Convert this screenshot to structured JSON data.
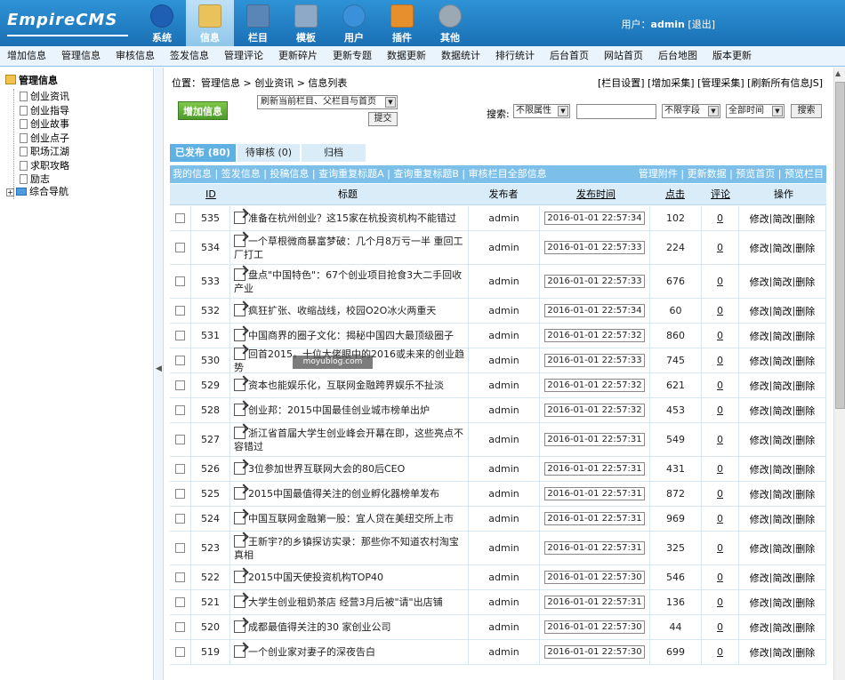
{
  "header": {
    "logo_text": "EmpireCMS",
    "nav": [
      {
        "label": "系统",
        "icon": "globe-icon"
      },
      {
        "label": "信息",
        "icon": "document-edit-icon",
        "active": true
      },
      {
        "label": "栏目",
        "icon": "folder-icon"
      },
      {
        "label": "模板",
        "icon": "window-icon"
      },
      {
        "label": "用户",
        "icon": "user-icon"
      },
      {
        "label": "插件",
        "icon": "tools-icon"
      },
      {
        "label": "其他",
        "icon": "gear-icon"
      }
    ],
    "user_label": "用户：",
    "user_name": "admin",
    "logout": "[退出]"
  },
  "subnav": [
    "增加信息",
    "管理信息",
    "审核信息",
    "签发信息",
    "管理评论",
    "更新碎片",
    "更新专题",
    "数据更新",
    "数据统计",
    "排行统计",
    "后台首页",
    "网站首页",
    "后台地图",
    "版本更新"
  ],
  "sidebar": {
    "root": "管理信息",
    "items": [
      "创业资讯",
      "创业指导",
      "创业故事",
      "创业点子",
      "职场江湖",
      "求职攻略",
      "励志"
    ],
    "group": "综合导航"
  },
  "main": {
    "crumb_prefix": "位置：",
    "crumb": "管理信息 > 创业资讯 > 信息列表",
    "toplinks": "[栏目设置] [增加采集] [管理采集] [刷新所有信息JS]",
    "add_button": "增加信息",
    "refresh_select": "刷新当前栏目、父栏目与首页",
    "submit": "提交",
    "search_label": "搜索:",
    "attr_select": "不限属性",
    "field_select": "不限字段",
    "time_select": "全部时间",
    "search_button": "搜索",
    "tabs": [
      "已发布 (80)",
      "待审核 (0)",
      "归档"
    ],
    "band_left": "我的信息 | 签发信息 | 投稿信息 | 查询重复标题A | 查询重复标题B | 审核栏目全部信息",
    "band_right": "管理附件 | 更新数据 | 预览首页 | 预览栏目",
    "columns": {
      "id": "ID",
      "title": "标题",
      "author": "发布者",
      "time": "发布时间",
      "hits": "点击",
      "comments": "评论",
      "ops": "操作"
    },
    "op_labels": {
      "edit": "修改",
      "simple": "简改",
      "delete": "删除"
    }
  },
  "rows": [
    {
      "id": "535",
      "title": "准备在杭州创业？这15家在杭投资机构不能错过",
      "author": "admin",
      "time": "2016-01-01 22:57:34",
      "hits": "102",
      "comments": "0",
      "tall": false
    },
    {
      "id": "534",
      "title": "一个草根微商暴富梦破：几个月8万亏一半 重回工厂打工",
      "author": "admin",
      "time": "2016-01-01 22:57:33",
      "hits": "224",
      "comments": "0",
      "tall": true
    },
    {
      "id": "533",
      "title": "盘点\"中国特色\"：67个创业项目抢食3大二手回收产业",
      "author": "admin",
      "time": "2016-01-01 22:57:33",
      "hits": "676",
      "comments": "0",
      "tall": true
    },
    {
      "id": "532",
      "title": "疯狂扩张、收缩战线，校园O2O冰火两重天",
      "author": "admin",
      "time": "2016-01-01 22:57:34",
      "hits": "60",
      "comments": "0",
      "tall": false
    },
    {
      "id": "531",
      "title": "中国商界的圈子文化：揭秘中国四大最顶级圈子",
      "author": "admin",
      "time": "2016-01-01 22:57:32",
      "hits": "860",
      "comments": "0",
      "tall": false
    },
    {
      "id": "530",
      "title": "回首2015，十位大佬眼中的2016或未来的创业趋势",
      "author": "admin",
      "time": "2016-01-01 22:57:33",
      "hits": "745",
      "comments": "0",
      "tall": false
    },
    {
      "id": "529",
      "title": "资本也能娱乐化，互联网金融跨界娱乐不扯淡",
      "author": "admin",
      "time": "2016-01-01 22:57:32",
      "hits": "621",
      "comments": "0",
      "tall": false
    },
    {
      "id": "528",
      "title": "创业邦：2015中国最佳创业城市榜单出炉",
      "author": "admin",
      "time": "2016-01-01 22:57:32",
      "hits": "453",
      "comments": "0",
      "tall": false
    },
    {
      "id": "527",
      "title": "浙江省首届大学生创业峰会开幕在即，这些亮点不容错过",
      "author": "admin",
      "time": "2016-01-01 22:57:31",
      "hits": "549",
      "comments": "0",
      "tall": true
    },
    {
      "id": "526",
      "title": "3位参加世界互联网大会的80后CEO",
      "author": "admin",
      "time": "2016-01-01 22:57:31",
      "hits": "431",
      "comments": "0",
      "tall": false
    },
    {
      "id": "525",
      "title": "2015中国最值得关注的创业孵化器榜单发布",
      "author": "admin",
      "time": "2016-01-01 22:57:31",
      "hits": "872",
      "comments": "0",
      "tall": false
    },
    {
      "id": "524",
      "title": "中国互联网金融第一股：宜人贷在美纽交所上市",
      "author": "admin",
      "time": "2016-01-01 22:57:31",
      "hits": "969",
      "comments": "0",
      "tall": false
    },
    {
      "id": "523",
      "title": "王新宇?的乡镇探访实录：那些你不知道农村淘宝真相",
      "author": "admin",
      "time": "2016-01-01 22:57:31",
      "hits": "325",
      "comments": "0",
      "tall": true
    },
    {
      "id": "522",
      "title": "2015中国天使投资机构TOP40",
      "author": "admin",
      "time": "2016-01-01 22:57:30",
      "hits": "546",
      "comments": "0",
      "tall": false
    },
    {
      "id": "521",
      "title": "大学生创业租奶茶店 经营3月后被\"请\"出店铺",
      "author": "admin",
      "time": "2016-01-01 22:57:31",
      "hits": "136",
      "comments": "0",
      "tall": false
    },
    {
      "id": "520",
      "title": "成都最值得关注的30 家创业公司",
      "author": "admin",
      "time": "2016-01-01 22:57:30",
      "hits": "44",
      "comments": "0",
      "tall": false
    },
    {
      "id": "519",
      "title": "一个创业家对妻子的深夜告白",
      "author": "admin",
      "time": "2016-01-01 22:57:30",
      "hits": "699",
      "comments": "0",
      "tall": false
    }
  ],
  "watermark": "moyublog.com"
}
